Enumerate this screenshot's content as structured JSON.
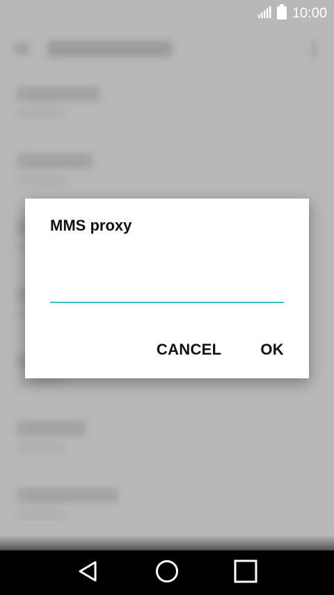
{
  "status_bar": {
    "time": "10:00",
    "signal_icon": "signal-icon",
    "battery_icon": "battery-icon"
  },
  "dialog": {
    "title": "MMS proxy",
    "input_value": "",
    "cancel_label": "CANCEL",
    "ok_label": "OK",
    "accent_color": "#2ec4b6"
  },
  "nav_bar": {
    "back_icon": "back-icon",
    "home_icon": "home-icon",
    "recents_icon": "recents-icon"
  }
}
